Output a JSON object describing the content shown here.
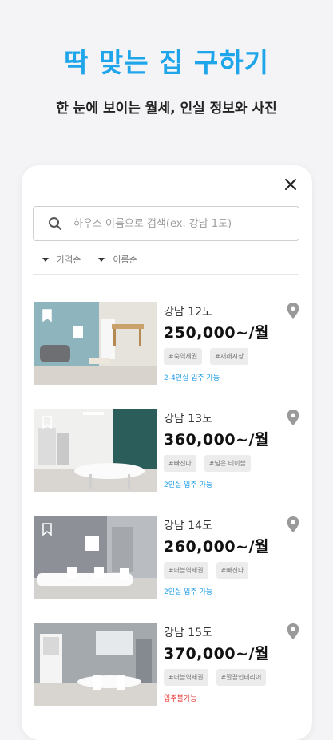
{
  "hero": {
    "title": "딱 맞는 집 구하기",
    "subtitle": "한 눈에 보이는 월세, 인실 정보와 사진"
  },
  "search": {
    "placeholder": "하우스 이름으로 검색(ex. 강남 1도)"
  },
  "sorts": [
    {
      "label": "가격순"
    },
    {
      "label": "이름순"
    }
  ],
  "listings": [
    {
      "name": "강남 12도",
      "price": "250,000~/월",
      "tags": [
        "#숙역세권",
        "#재래시장"
      ],
      "status": "2-4인실 입주 가능",
      "status_color": "#1e9be6",
      "wall": "#8eb4bd"
    },
    {
      "name": "강남 13도",
      "price": "360,000~/월",
      "tags": [
        "#빠진다",
        "#넓은 테이블"
      ],
      "status": "2인실 입주 가능",
      "status_color": "#1e9be6",
      "wall": "#2b5e5a"
    },
    {
      "name": "강남 14도",
      "price": "260,000~/월",
      "tags": [
        "#더블역세권",
        "#빠진다"
      ],
      "status": "2인실 입주 가능",
      "status_color": "#1e9be6",
      "wall": "#8d9096"
    },
    {
      "name": "강남 15도",
      "price": "370,000~/월",
      "tags": [
        "#더블역세권",
        "#깔끔인테리어"
      ],
      "status": "입주불가능",
      "status_color": "#e53935",
      "wall": "#9aa0a6"
    }
  ],
  "colors": {
    "accent": "#1fa6ea",
    "available": "#1e9be6",
    "unavailable": "#e53935"
  }
}
